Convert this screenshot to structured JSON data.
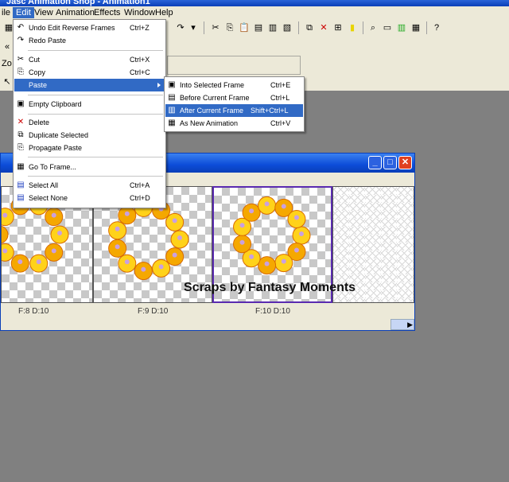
{
  "app": {
    "title": "Jasc Animation Shop - Animation1"
  },
  "menubar": [
    "ile",
    "Edit",
    "View",
    "Animation",
    "Effects",
    "Window",
    "Help"
  ],
  "toolbar2": {
    "label": "Zo"
  },
  "edit_menu": {
    "items": [
      {
        "label": "Undo Edit Reverse Frames",
        "shortcut": "Ctrl+Z"
      },
      {
        "label": "Redo Paste",
        "shortcut": ""
      },
      {
        "label": "Cut",
        "shortcut": "Ctrl+X"
      },
      {
        "label": "Copy",
        "shortcut": "Ctrl+C"
      },
      {
        "label": "Paste",
        "shortcut": ""
      },
      {
        "label": "Empty Clipboard",
        "shortcut": ""
      },
      {
        "label": "Delete",
        "shortcut": ""
      },
      {
        "label": "Duplicate Selected",
        "shortcut": ""
      },
      {
        "label": "Propagate Paste",
        "shortcut": ""
      },
      {
        "label": "Go To Frame...",
        "shortcut": ""
      },
      {
        "label": "Select All",
        "shortcut": "Ctrl+A"
      },
      {
        "label": "Select None",
        "shortcut": "Ctrl+D"
      }
    ]
  },
  "paste_submenu": {
    "items": [
      {
        "label": "Into Selected Frame",
        "shortcut": "Ctrl+E"
      },
      {
        "label": "Before Current Frame",
        "shortcut": "Ctrl+L"
      },
      {
        "label": "After Current Frame",
        "shortcut": "Shift+Ctrl+L"
      },
      {
        "label": "As New Animation",
        "shortcut": "Ctrl+V"
      }
    ]
  },
  "frames": [
    {
      "label": "F:8  D:10"
    },
    {
      "label": "F:9  D:10"
    },
    {
      "label": "F:10  D:10"
    }
  ],
  "watermark": "Scraps by Fantasy Moments"
}
